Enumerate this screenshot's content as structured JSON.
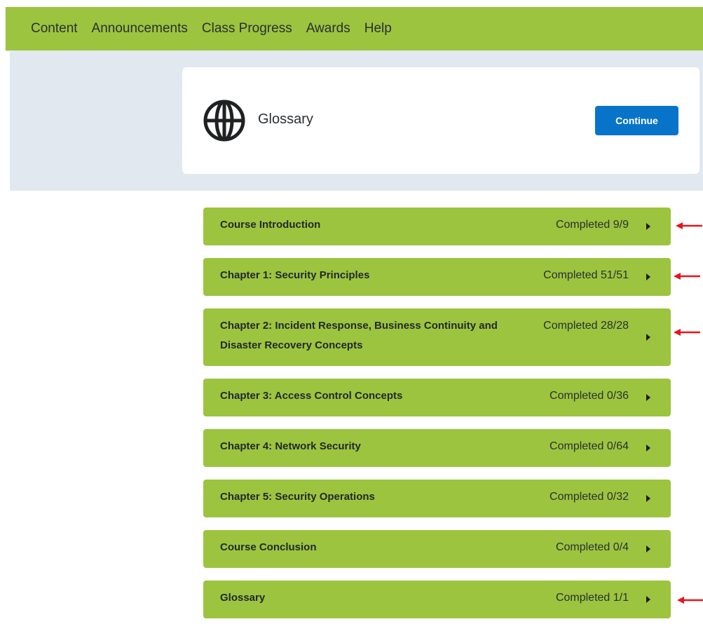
{
  "nav": {
    "items": [
      {
        "label": "Content"
      },
      {
        "label": "Announcements"
      },
      {
        "label": "Class Progress"
      },
      {
        "label": "Awards"
      },
      {
        "label": "Help"
      }
    ]
  },
  "hero": {
    "icon": "globe-icon",
    "title": "Glossary",
    "continue_label": "Continue"
  },
  "modules": [
    {
      "title": "Course Introduction",
      "status": "Completed 9/9",
      "progress": {
        "done": 9,
        "total": 9
      }
    },
    {
      "title": "Chapter 1: Security Principles",
      "status": "Completed 51/51",
      "progress": {
        "done": 51,
        "total": 51
      }
    },
    {
      "title": "Chapter 2: Incident Response, Business Continuity and Disaster Recovery Concepts",
      "status": "Completed 28/28",
      "progress": {
        "done": 28,
        "total": 28
      }
    },
    {
      "title": "Chapter 3: Access Control Concepts",
      "status": "Completed 0/36",
      "progress": {
        "done": 0,
        "total": 36
      }
    },
    {
      "title": "Chapter 4: Network Security",
      "status": "Completed 0/64",
      "progress": {
        "done": 0,
        "total": 64
      }
    },
    {
      "title": "Chapter 5: Security Operations",
      "status": "Completed 0/32",
      "progress": {
        "done": 0,
        "total": 32
      }
    },
    {
      "title": "Course Conclusion",
      "status": "Completed 0/4",
      "progress": {
        "done": 0,
        "total": 4
      }
    },
    {
      "title": "Glossary",
      "status": "Completed 1/1",
      "progress": {
        "done": 1,
        "total": 1
      }
    }
  ],
  "colors": {
    "nav_bg": "#9cc43f",
    "module_bg": "#9cc43f",
    "hero_bg": "#e2e8f0",
    "button_bg": "#0874c9",
    "annotation_arrow": "#e8141b"
  }
}
